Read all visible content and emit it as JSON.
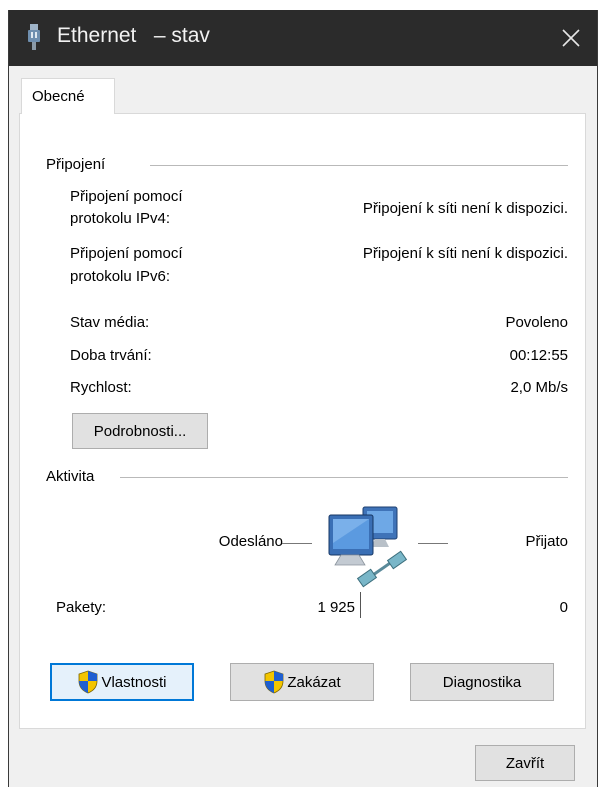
{
  "window": {
    "title": "Ethernet   – stav",
    "close_label": "✕"
  },
  "tabs": [
    {
      "label": "Obecné"
    }
  ],
  "connection": {
    "group_label": "Připojení",
    "ipv4_label_line1": "Připojení pomocí",
    "ipv4_label_line2": "protokolu IPv4:",
    "ipv4_value": "Připojení k síti není k dispozici.",
    "ipv6_label_line1": "Připojení pomocí",
    "ipv6_label_line2": "protokolu IPv6:",
    "ipv6_value": "Připojení k síti není k dispozici.",
    "media_state_label": "Stav média:",
    "media_state_value": "Povoleno",
    "duration_label": "Doba trvání:",
    "duration_value": "00:12:55",
    "speed_label": "Rychlost:",
    "speed_value": "2,0 Mb/s",
    "details_button": "Podrobnosti..."
  },
  "activity": {
    "group_label": "Aktivita",
    "sent_label": "Odesláno",
    "received_label": "Přijato",
    "packets_label": "Pakety:",
    "packets_sent": "1 925",
    "packets_received": "0",
    "icon": "network-computers-icon"
  },
  "actions": {
    "properties_button": "Vlastnosti",
    "disable_button": "Zakázat",
    "diagnose_button": "Diagnostika",
    "close_button": "Zavřít",
    "shield_icon": "uac-shield-icon"
  },
  "colors": {
    "titlebar": "#2b2b2b",
    "focus_border": "#0078d7",
    "button_bg": "#e1e1e1",
    "window_bg": "#f0f0f0"
  }
}
